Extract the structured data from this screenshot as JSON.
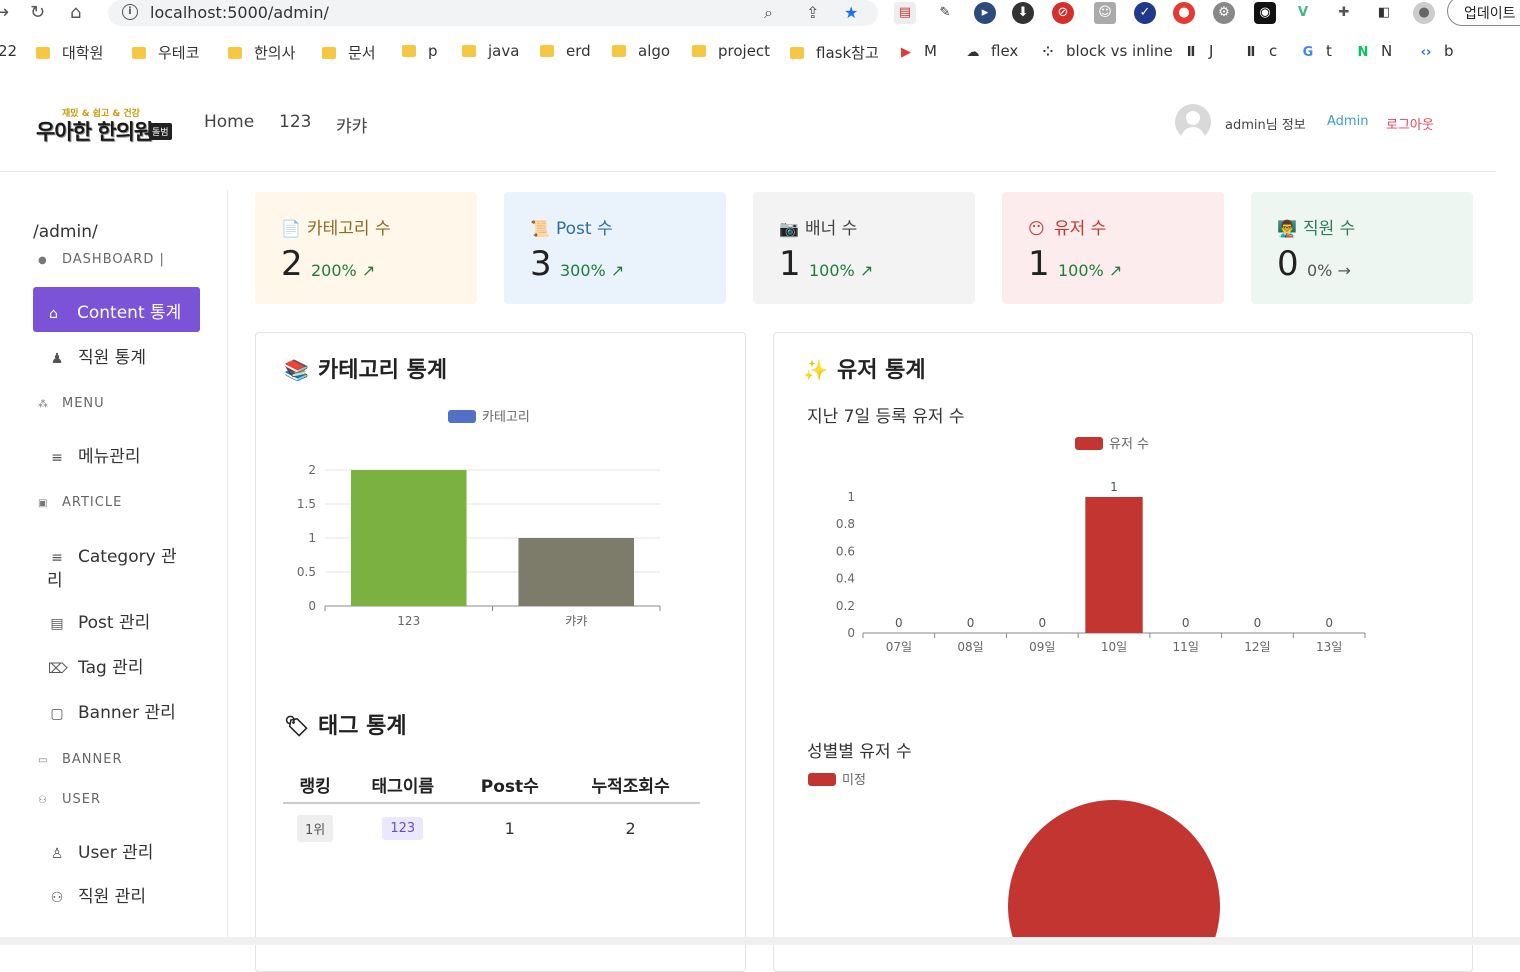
{
  "browser": {
    "url": "localhost:5000/admin/",
    "update_label": "업데이트",
    "bookmarks": [
      {
        "label": "22",
        "kind": "text"
      },
      {
        "label": "대학원",
        "kind": "folder"
      },
      {
        "label": "우테코",
        "kind": "folder"
      },
      {
        "label": "한의사",
        "kind": "folder"
      },
      {
        "label": "문서",
        "kind": "folder"
      },
      {
        "label": "p",
        "kind": "folder"
      },
      {
        "label": "java",
        "kind": "folder"
      },
      {
        "label": "erd",
        "kind": "folder"
      },
      {
        "label": "algo",
        "kind": "folder"
      },
      {
        "label": "project",
        "kind": "folder"
      },
      {
        "label": "flask참고",
        "kind": "folder"
      },
      {
        "label": "M",
        "kind": "youtube"
      },
      {
        "label": "flex",
        "kind": "cloud"
      },
      {
        "label": "block vs inline",
        "kind": "dots"
      },
      {
        "label": "J",
        "kind": "icon"
      },
      {
        "label": "c",
        "kind": "icon"
      },
      {
        "label": "t",
        "kind": "google"
      },
      {
        "label": "N",
        "kind": "naver"
      },
      {
        "label": "b",
        "kind": "code"
      }
    ]
  },
  "header": {
    "logo_sub": "재밌 & 쉽고 & 건강",
    "logo_main": "우아한 한의원",
    "logo_tag": "돌범",
    "nav": [
      "Home",
      "123",
      "캬캬"
    ],
    "user_info": "admin님 정보",
    "admin_link": "Admin",
    "logout": "로그아웃",
    "colors": {
      "admin": "#3a9bd8",
      "logout": "#e0445a"
    }
  },
  "sidebar": {
    "path": "/admin/",
    "dashboard_label": "DASHBOARD |",
    "active_item": "Content 통계",
    "staff_stats": "직원 통계",
    "menu_label": "MENU",
    "menu_manage": "메뉴관리",
    "article_label": "ARTICLE",
    "category_manage_1": "Category 관",
    "category_manage_2": "리",
    "post_manage": "Post 관리",
    "tag_manage": "Tag 관리",
    "banner_manage": "Banner 관리",
    "banner_label": "BANNER",
    "user_label": "USER",
    "user_manage": "User 관리",
    "staff_manage": "직원 관리",
    "accent": "#7b53d6"
  },
  "cards": [
    {
      "title": "카테고리 수",
      "emoji": "📄",
      "count": "2",
      "pct": "200% ↗",
      "bg": "#fff8ea",
      "title_color": "#8a6c24",
      "pct_color": "#1e7d3a"
    },
    {
      "title": "Post 수",
      "emoji": "📜",
      "count": "3",
      "pct": "300% ↗",
      "bg": "#eaf2fb",
      "title_color": "#2c6ea7",
      "pct_color": "#1e7d3a"
    },
    {
      "title": "배너 수",
      "emoji": "📷",
      "count": "1",
      "pct": "100% ↗",
      "bg": "#f3f3f3",
      "title_color": "#444",
      "pct_color": "#1e7d3a"
    },
    {
      "title": "유저 수",
      "emoji": "😶",
      "count": "1",
      "pct": "100% ↗",
      "bg": "#fdecee",
      "title_color": "#c0392b",
      "pct_color": "#1e7d3a"
    },
    {
      "title": "직원 수",
      "emoji": "👨‍🏫",
      "count": "0",
      "pct": "0% →",
      "bg": "#eef6f1",
      "title_color": "#2e7d5b",
      "pct_color": "#555"
    }
  ],
  "category_panel": {
    "title": "카테고리 통계",
    "emoji": "📚",
    "legend": "카테고리",
    "legend_color": "#5470c6"
  },
  "tag_panel": {
    "title": "태그 통계",
    "emoji": "🏷",
    "headers": [
      "랭킹",
      "태그이름",
      "Post수",
      "누적조회수"
    ],
    "rows": [
      {
        "rank": "1위",
        "name": "123",
        "posts": "1",
        "views": "2"
      }
    ]
  },
  "user_panel": {
    "title": "유저 통계",
    "emoji": "✨",
    "weekly_title": "지난 7일 등록 유저 수",
    "weekly_legend": "유저 수",
    "gender_title": "성별별 유저 수",
    "gender_legend": "미정",
    "bar_color": "#c23531"
  },
  "chart_data": [
    {
      "type": "bar",
      "title": "",
      "categories": [
        "123",
        "캬캬"
      ],
      "series": [
        {
          "name": "카테고리",
          "values": [
            2,
            1
          ]
        }
      ],
      "bar_colors": [
        "#7ab140",
        "#7d7b69"
      ],
      "ylim": [
        0,
        2
      ],
      "yticks": [
        "0",
        "0.5",
        "1",
        "1.5",
        "2"
      ],
      "grid": true,
      "legend": "top"
    },
    {
      "type": "bar",
      "title": "지난 7일 등록 유저 수",
      "categories": [
        "07일",
        "08일",
        "09일",
        "10일",
        "11일",
        "12일",
        "13일"
      ],
      "series": [
        {
          "name": "유저 수",
          "values": [
            0,
            0,
            0,
            1,
            0,
            0,
            0
          ]
        }
      ],
      "ylim": [
        0,
        1
      ],
      "yticks": [
        "0",
        "0.2",
        "0.4",
        "0.6",
        "0.8",
        "1"
      ],
      "data_labels": true,
      "grid": false,
      "legend": "top"
    },
    {
      "type": "pie",
      "title": "성별별 유저 수",
      "categories": [
        "미정"
      ],
      "values": [
        1
      ],
      "legend": "top-left"
    }
  ]
}
